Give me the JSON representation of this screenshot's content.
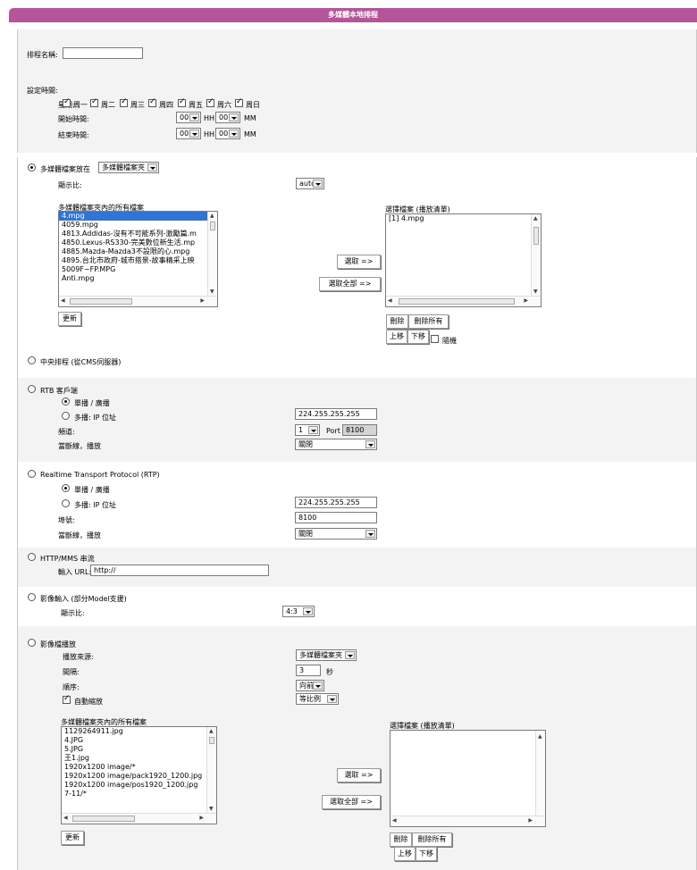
{
  "title": "多媒體本地排程",
  "schedule_name_label": "排程名稱:",
  "schedule_name_value": "",
  "settime_label": "設定時間:",
  "week_label": "星期:",
  "days": [
    "周一",
    "周二",
    "周三",
    "周四",
    "周五",
    "周六",
    "周日"
  ],
  "start_label": "開始時間:",
  "end_label": "結束時間:",
  "hh": "HH",
  "mm": "MM",
  "time_value": "00",
  "mm_section": {
    "label": "多媒體檔案放在",
    "location": "多媒體檔案夾",
    "ratio_label": "顯示比:",
    "ratio_value": "auto",
    "files_label": "多媒體檔案夾內的所有檔案",
    "files": [
      "4.mpg",
      "4059.mpg",
      "4813.Addidas-沒有不可能系列-激勵篇.m",
      "4850.Lexus-RS330-完美數位新生活.mp",
      "4885.Mazda-Mazda3不設限的心.mpg",
      "4895.台北市政府-城市搭景-故事精采上映",
      "5009F~FP.MPG",
      "Anti.mpg"
    ],
    "selected_label": "選擇檔案 (播放清單)",
    "selected": [
      "[1] 4.mpg"
    ],
    "pick": "選取 =>",
    "pick_all": "選取全部 =>",
    "refresh": "更新",
    "delete": "刪除",
    "delete_all": "刪除所有",
    "up": "上移",
    "down": "下移",
    "random": "隨機"
  },
  "central": "中央排程 (從CMS伺服器)",
  "rtb": {
    "label": "RTB 客戶端",
    "unicast": "單播 / 廣播",
    "multicast": "多播: IP 位址",
    "ip": "224.255.255.255",
    "channel_label": "頻道:",
    "channel": "1",
    "port_label": "Port",
    "port": "8100",
    "offline_label": "當斷線，播放",
    "offline": "關閉"
  },
  "rtp": {
    "label": "Realtime Transport Protocol (RTP)",
    "unicast": "單播 / 廣播",
    "multicast": "多播: IP 位址",
    "ip": "224.255.255.255",
    "port_label": "埠號:",
    "port": "8100",
    "offline_label": "當斷線，播放",
    "offline": "關閉"
  },
  "http": {
    "label": "HTTP/MMS 串流",
    "url_label": "輸入 URL:",
    "url": "http://"
  },
  "video_in": {
    "label": "影像輸入 (部分Model支援)",
    "ratio_label": "顯示比:",
    "ratio": "4:3"
  },
  "image": {
    "label": "影像檔播放",
    "source_label": "播放來源:",
    "source": "多媒體檔案夾",
    "interval_label": "間隔:",
    "interval": "3",
    "sec": "秒",
    "order_label": "順序:",
    "order": "向前",
    "autoscale": "自動縮放",
    "scale_mode": "等比例",
    "files_label": "多媒體檔案夾內的所有檔案",
    "files": [
      "1129264911.jpg",
      "4.JPG",
      "5.JPG",
      "王1.jpg",
      "1920x1200 image/*",
      "1920x1200 image/pack1920_1200.jpg",
      "1920x1200 image/pos1920_1200.jpg",
      "7-11/*"
    ],
    "selected_label": "選擇檔案 (播放清單)",
    "pick": "選取 =>",
    "pick_all": "選取全部 =>",
    "refresh": "更新",
    "delete": "刪除",
    "delete_all": "刪除所有",
    "up": "上移",
    "down": "下移"
  },
  "icons": {
    "dropdown": "chevron-down-icon",
    "check": "check-icon"
  }
}
